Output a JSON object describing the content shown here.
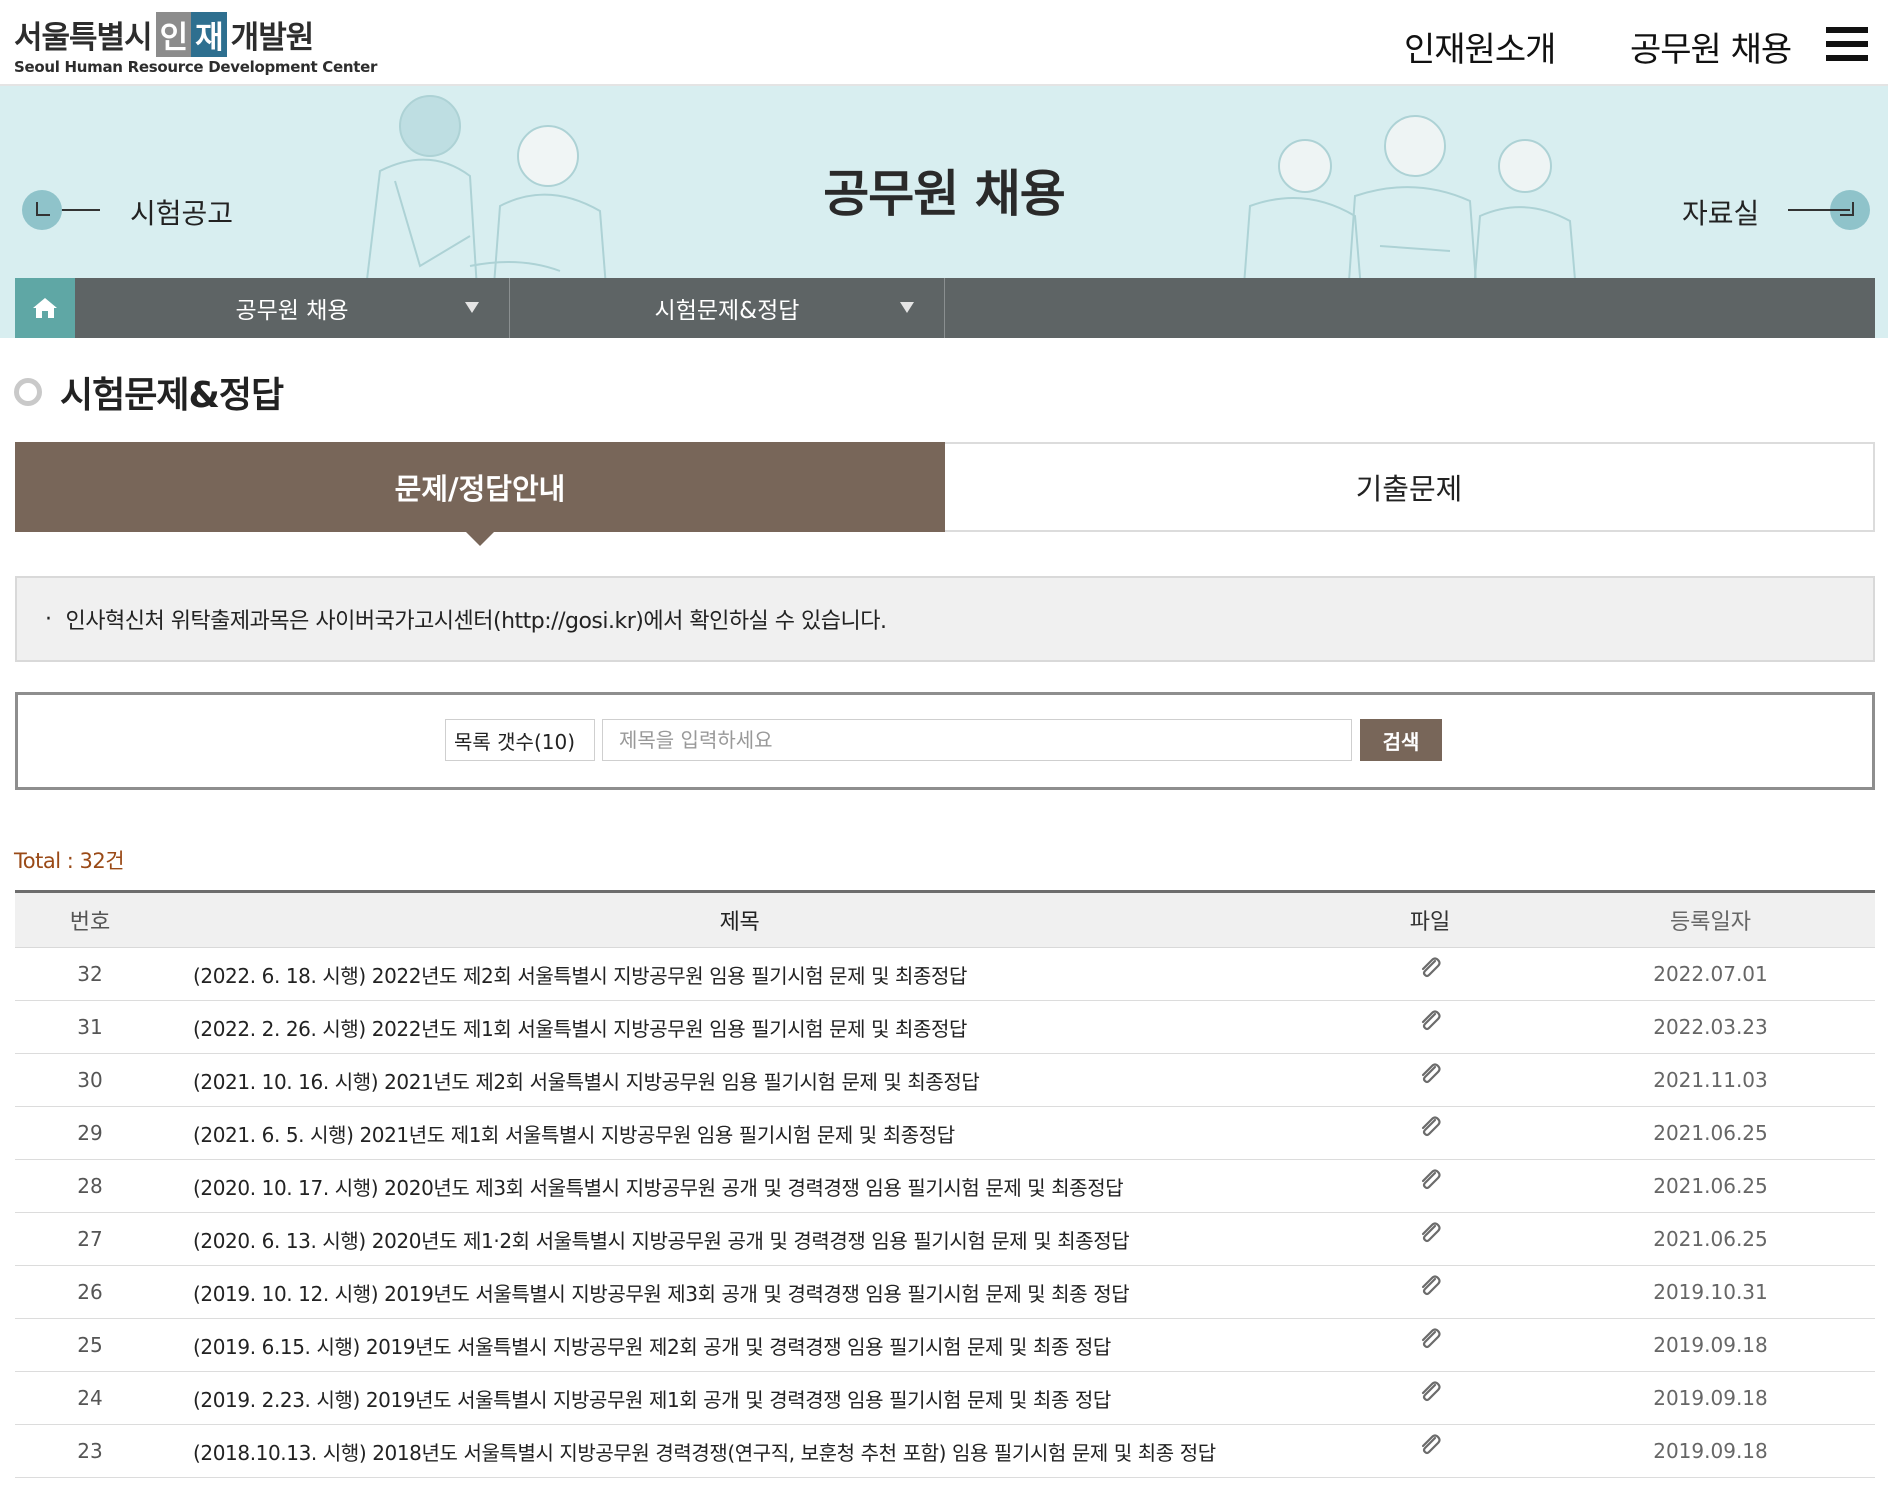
{
  "header": {
    "logo_ko_a": "서울특별시",
    "logo_ko_b": "인",
    "logo_ko_c": "재",
    "logo_ko_d": "개발원",
    "logo_en": "Seoul Human Resource Development Center",
    "nav_intro": "인재원소개",
    "nav_recruit": "공무원 채용"
  },
  "banner": {
    "title": "공무원 채용",
    "prev_label": "시험공고",
    "next_label": "자료실"
  },
  "breadcrumb": {
    "items": [
      {
        "label": "공무원 채용"
      },
      {
        "label": "시험문제&정답"
      }
    ]
  },
  "page": {
    "heading": "시험문제&정답"
  },
  "tabs": [
    {
      "label": "문제/정답안내",
      "active": true
    },
    {
      "label": "기출문제",
      "active": false
    }
  ],
  "notice": {
    "bullet": "·",
    "text": "인사혁신처 위탁출제과목은 사이버국가고시센터(http://gosi.kr)에서 확인하실 수 있습니다."
  },
  "search": {
    "select_value": "목록 갯수(10)",
    "placeholder": "제목을 입력하세요",
    "button_label": "검색"
  },
  "total_text": "Total : 32건",
  "table": {
    "headers": {
      "no": "번호",
      "title": "제목",
      "file": "파일",
      "date": "등록일자"
    },
    "rows": [
      {
        "no": "32",
        "title": "(2022. 6. 18. 시행) 2022년도 제2회 서울특별시 지방공무원 임용 필기시험 문제 및 최종정답",
        "date": "2022.07.01"
      },
      {
        "no": "31",
        "title": "(2022. 2. 26. 시행) 2022년도 제1회 서울특별시 지방공무원 임용 필기시험 문제 및 최종정답",
        "date": "2022.03.23"
      },
      {
        "no": "30",
        "title": "(2021. 10. 16. 시행) 2021년도 제2회 서울특별시 지방공무원 임용 필기시험 문제 및 최종정답",
        "date": "2021.11.03"
      },
      {
        "no": "29",
        "title": "(2021. 6. 5. 시행) 2021년도 제1회 서울특별시 지방공무원 임용 필기시험 문제 및 최종정답",
        "date": "2021.06.25"
      },
      {
        "no": "28",
        "title": "(2020. 10. 17. 시행) 2020년도 제3회 서울특별시 지방공무원 공개 및 경력경쟁 임용 필기시험 문제 및 최종정답",
        "date": "2021.06.25"
      },
      {
        "no": "27",
        "title": "(2020. 6. 13. 시행) 2020년도 제1·2회 서울특별시 지방공무원 공개 및 경력경쟁 임용 필기시험 문제 및 최종정답",
        "date": "2021.06.25"
      },
      {
        "no": "26",
        "title": "(2019. 10. 12. 시행) 2019년도 서울특별시 지방공무원 제3회 공개 및 경력경쟁 임용 필기시험 문제 및 최종 정답",
        "date": "2019.10.31"
      },
      {
        "no": "25",
        "title": "(2019. 6.15. 시행) 2019년도 서울특별시 지방공무원 제2회 공개 및 경력경쟁 임용 필기시험 문제 및 최종 정답",
        "date": "2019.09.18"
      },
      {
        "no": "24",
        "title": "(2019. 2.23. 시행) 2019년도 서울특별시 지방공무원 제1회 공개 및 경력경쟁 임용 필기시험 문제 및 최종 정답",
        "date": "2019.09.18"
      },
      {
        "no": "23",
        "title": "(2018.10.13. 시행) 2018년도 서울특별시 지방공무원 경력경쟁(연구직, 보훈청 추천 포함) 임용 필기시험 문제 및 최종 정답",
        "date": "2019.09.18"
      }
    ]
  },
  "icons": {
    "home": "home-icon",
    "attachment": "paperclip-icon",
    "menu": "hamburger-menu-icon",
    "prev": "arrow-left-icon",
    "next": "arrow-right-icon"
  },
  "colors": {
    "tab_active": "#786659",
    "banner_bg": "#d8eef0",
    "crumb_bar": "#5e6465",
    "home_bg": "#5fa7a5",
    "total_text": "#9a4a17"
  }
}
